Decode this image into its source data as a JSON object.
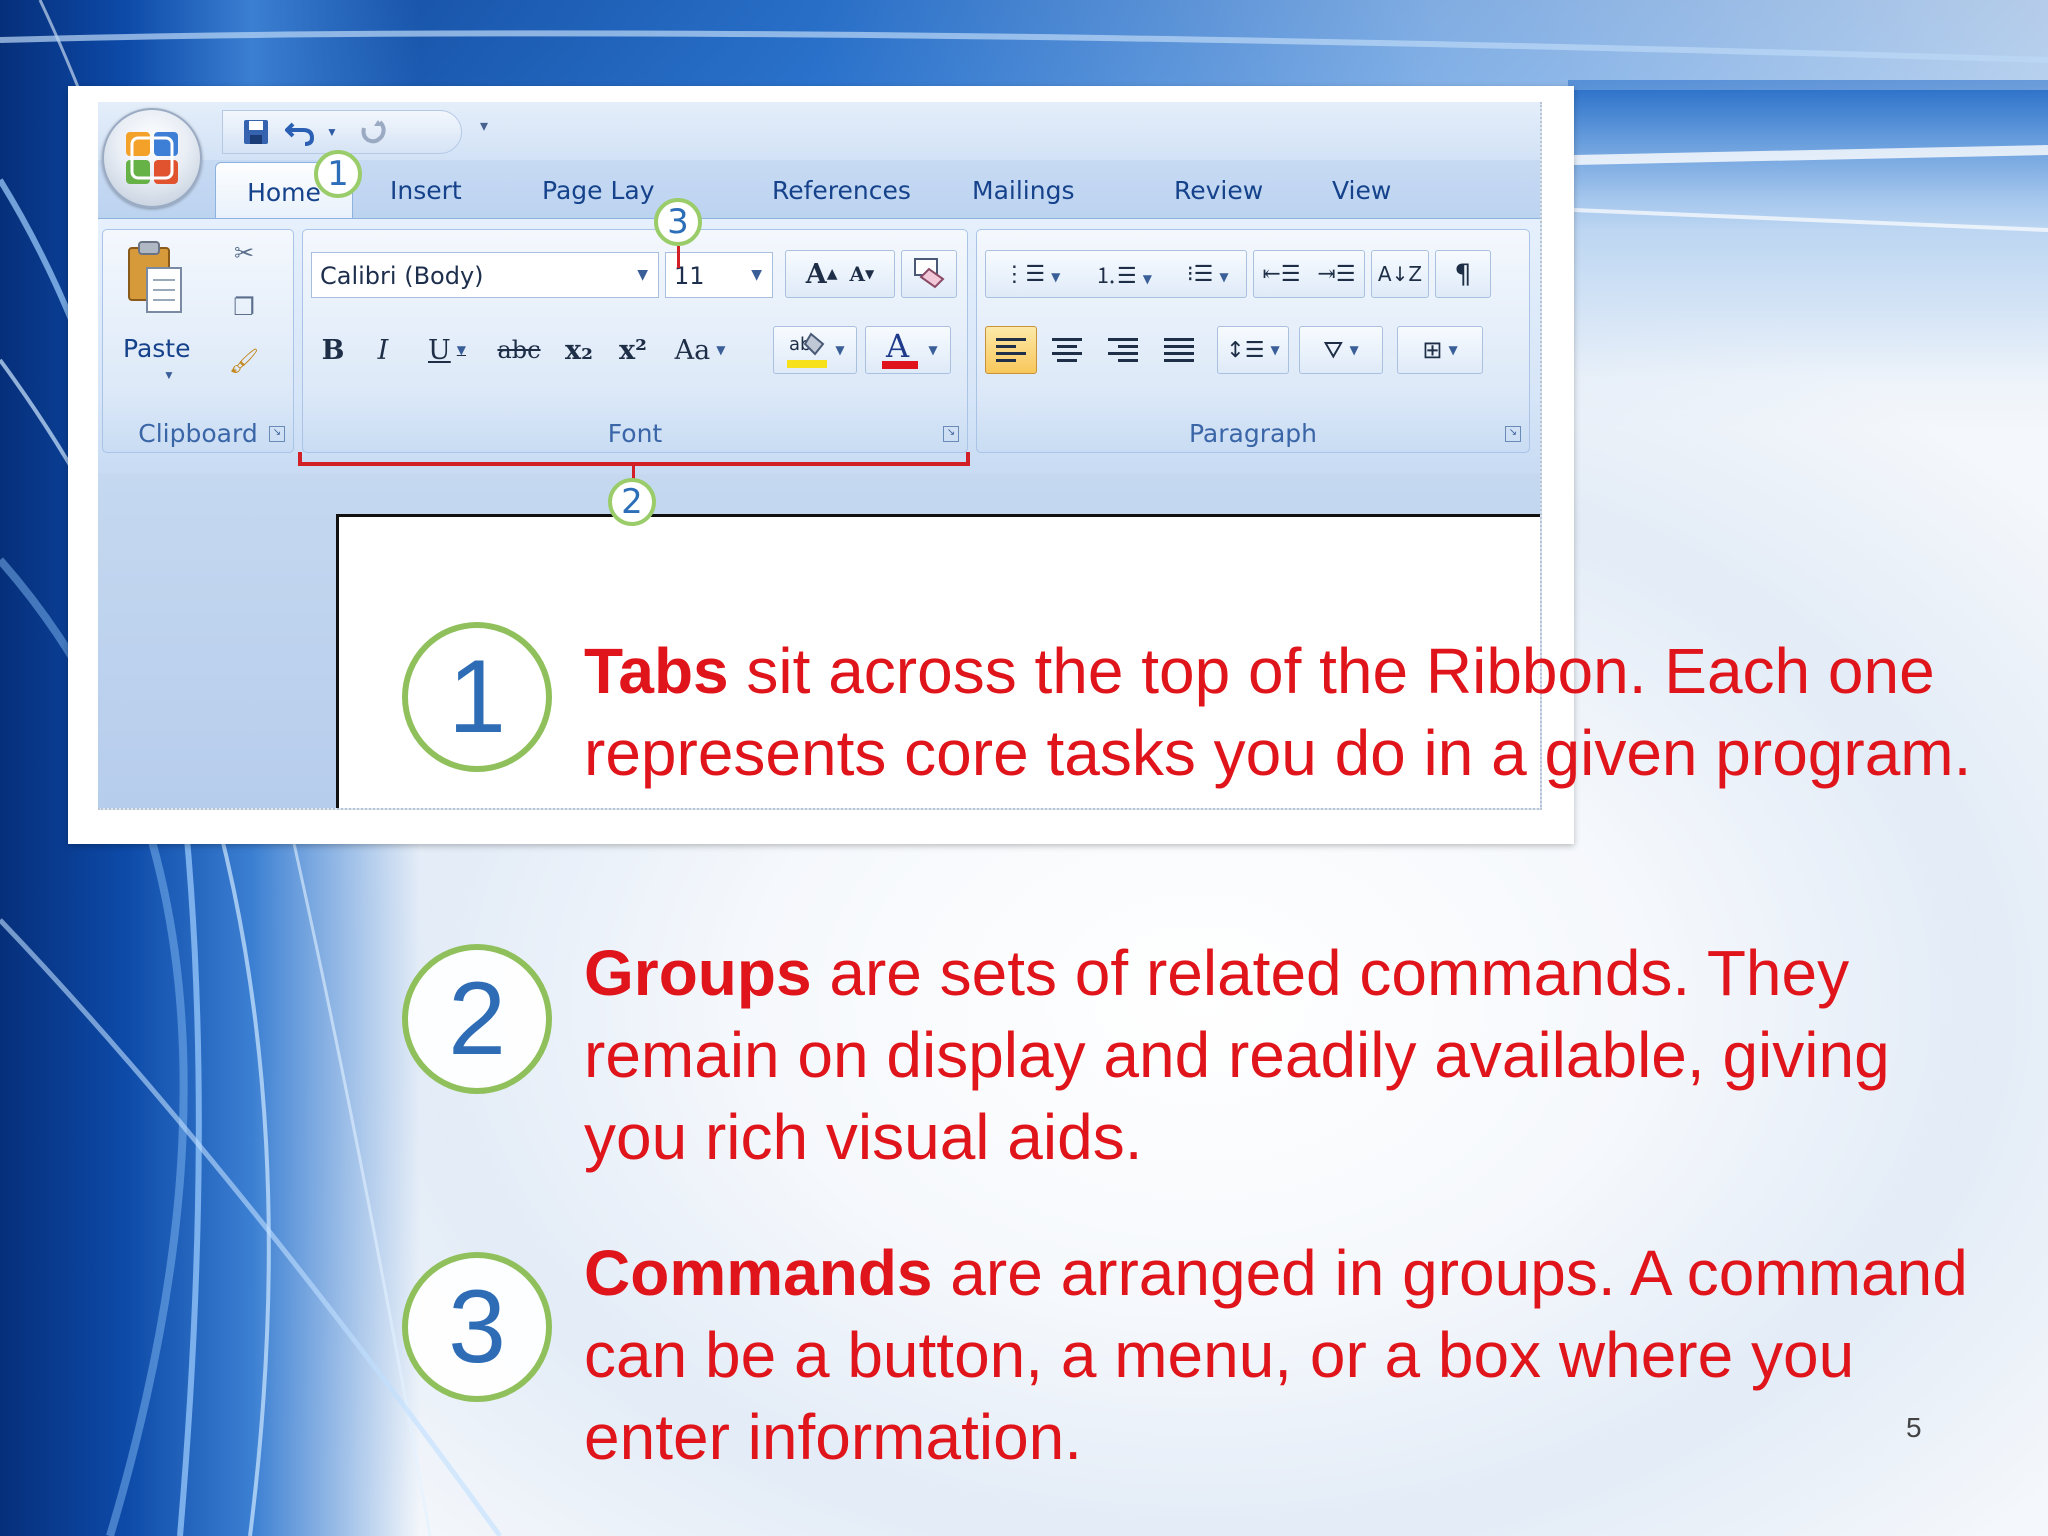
{
  "quick_access": {
    "save_icon": "save-icon",
    "undo_icon": "undo-icon",
    "redo_icon": "redo-icon"
  },
  "tabs": [
    "Home",
    "Insert",
    "Page Lay",
    "References",
    "Mailings",
    "Review",
    "View"
  ],
  "clipboard": {
    "paste_label": "Paste",
    "group_label": "Clipboard"
  },
  "font": {
    "name": "Calibri (Body)",
    "size": "11",
    "group_label": "Font",
    "bold": "B",
    "italic": "I",
    "underline": "U",
    "strikethrough": "abc",
    "subscript": "x₂",
    "superscript": "x²",
    "change_case": "Aa",
    "grow": "A",
    "shrink": "A",
    "highlight_color": "#f7e11b",
    "font_color": "#e0141b"
  },
  "paragraph": {
    "group_label": "Paragraph",
    "sort": "A↓Z",
    "show_marks": "¶"
  },
  "callouts": [
    "1",
    "2",
    "3"
  ],
  "items": [
    {
      "number": "1",
      "term": "Tabs",
      "text": " sit across the top of the Ribbon. Each one represents core tasks you do in a given program."
    },
    {
      "number": "2",
      "term": "Groups",
      "text": " are sets of related commands. They remain on display and readily available, giving you rich visual aids."
    },
    {
      "number": "3",
      "term": "Commands",
      "text": " are arranged in groups. A command can be a button, a menu, or a box where you enter information."
    }
  ],
  "page_number": "5",
  "colors": {
    "text_red": "#e0141b",
    "callout_green": "#8fc05b",
    "number_blue": "#2e6db5"
  }
}
